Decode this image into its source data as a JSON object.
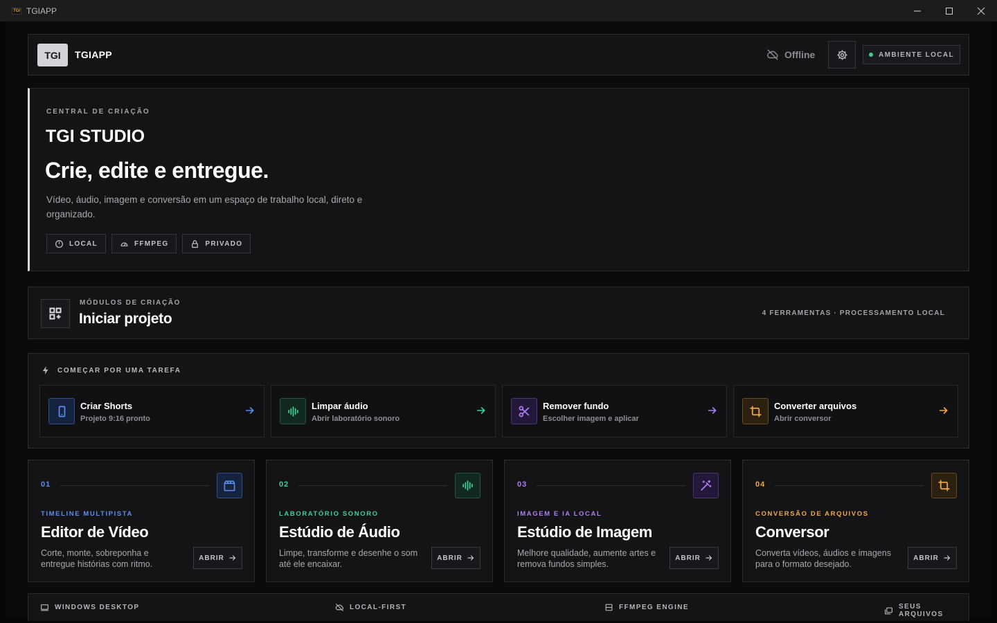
{
  "window": {
    "title": "TGIAPP",
    "logo_text": "TGI"
  },
  "header": {
    "logo": "TGI",
    "app_name": "TGIAPP",
    "status": "Offline",
    "env_badge": "AMBIENTE LOCAL",
    "env_dot_color": "#3fd18a"
  },
  "hero": {
    "kicker": "CENTRAL DE CRIAÇÃO",
    "brand": "TGI STUDIO",
    "title": "Crie, edite e entregue.",
    "description": "Vídeo, áudio, imagem e conversão em um espaço de trabalho local, direto e organizado.",
    "chips": [
      {
        "icon": "power-icon",
        "label": "LOCAL"
      },
      {
        "icon": "gauge-icon",
        "label": "FFMPEG"
      },
      {
        "icon": "lock-icon",
        "label": "PRIVADO"
      }
    ]
  },
  "modules": {
    "kicker": "MÓDULOS DE CRIAÇÃO",
    "title": "Iniciar projeto",
    "meta": "4 FERRAMENTAS · PROCESSAMENTO LOCAL"
  },
  "quick_tasks": {
    "heading": "COMEÇAR POR UMA TAREFA",
    "items": [
      {
        "title": "Criar Shorts",
        "subtitle": "Projeto 9:16 pronto",
        "icon": "phone-icon",
        "color": "#5b8def"
      },
      {
        "title": "Limpar áudio",
        "subtitle": "Abrir laboratório sonoro",
        "icon": "waveform-icon",
        "color": "#3ecf9a"
      },
      {
        "title": "Remover fundo",
        "subtitle": "Escolher imagem e aplicar",
        "icon": "scissors-icon",
        "color": "#b07cf0"
      },
      {
        "title": "Converter arquivos",
        "subtitle": "Abrir conversor",
        "icon": "crop-icon",
        "color": "#f0a84a"
      }
    ]
  },
  "tools": [
    {
      "num": "01",
      "kicker": "TIMELINE MULTIPISTA",
      "title": "Editor de Vídeo",
      "description": "Corte, monte, sobreponha e entregue histórias com ritmo.",
      "open": "ABRIR",
      "icon": "clapper-icon",
      "color": "#5b8def"
    },
    {
      "num": "02",
      "kicker": "LABORATÓRIO SONORO",
      "title": "Estúdio de Áudio",
      "description": "Limpe, transforme e desenhe o som até ele encaixar.",
      "open": "ABRIR",
      "icon": "waveform-icon",
      "color": "#3ecf9a"
    },
    {
      "num": "03",
      "kicker": "IMAGEM E IA LOCAL",
      "title": "Estúdio de Imagem",
      "description": "Melhore qualidade, aumente artes e remova fundos simples.",
      "open": "ABRIR",
      "icon": "magic-wand-icon",
      "color": "#b07cf0"
    },
    {
      "num": "04",
      "kicker": "CONVERSÃO DE ARQUIVOS",
      "title": "Conversor",
      "description": "Converta vídeos, áudios e imagens para o formato desejado.",
      "open": "ABRIR",
      "icon": "crop-icon",
      "color": "#f0a84a"
    }
  ],
  "footer": {
    "items": [
      {
        "icon": "monitor-icon",
        "label": "WINDOWS DESKTOP"
      },
      {
        "icon": "cloud-off-icon",
        "label": "LOCAL-FIRST"
      },
      {
        "icon": "server-icon",
        "label": "FFMPEG ENGINE"
      },
      {
        "icon": "folders-icon",
        "label": "SEUS ARQUIVOS"
      }
    ]
  }
}
